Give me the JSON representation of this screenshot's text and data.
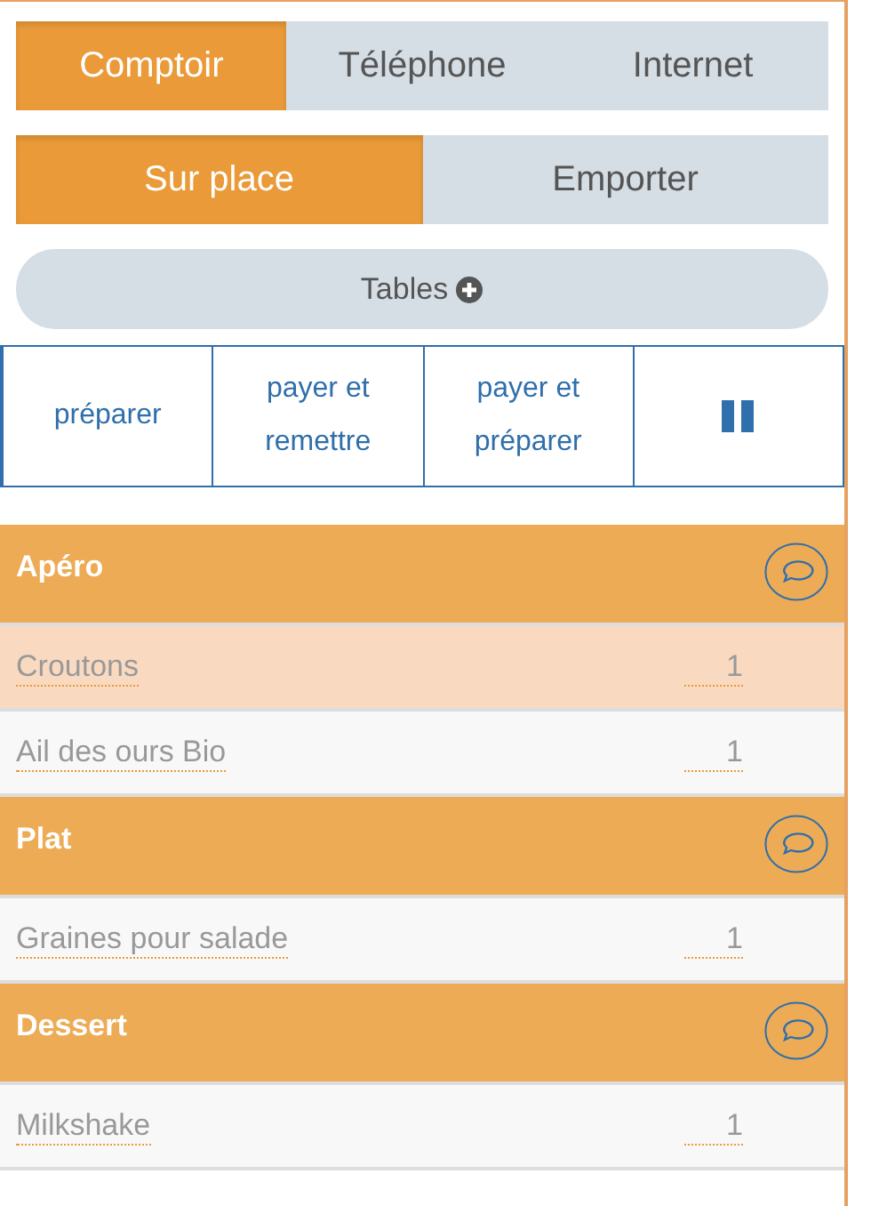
{
  "channel_tabs": [
    {
      "label": "Comptoir",
      "selected": true
    },
    {
      "label": "Téléphone",
      "selected": false
    },
    {
      "label": "Internet",
      "selected": false
    }
  ],
  "service_tabs": [
    {
      "label": "Sur place",
      "selected": true
    },
    {
      "label": "Emporter",
      "selected": false
    }
  ],
  "tables_button": {
    "label": "Tables"
  },
  "actions": [
    {
      "kind": "text",
      "label": "préparer"
    },
    {
      "kind": "text",
      "label": "payer et remettre"
    },
    {
      "kind": "text",
      "label": "payer et préparer"
    },
    {
      "kind": "pause"
    }
  ],
  "categories": [
    {
      "name": "Apéro",
      "items": [
        {
          "name": "Croutons",
          "quantity": "1",
          "selected": true
        },
        {
          "name": "Ail des ours Bio",
          "quantity": "1",
          "selected": false
        }
      ]
    },
    {
      "name": "Plat",
      "items": [
        {
          "name": "Graines pour salade",
          "quantity": "1",
          "selected": false
        }
      ]
    },
    {
      "name": "Dessert",
      "items": [
        {
          "name": "Milkshake",
          "quantity": "1",
          "selected": false
        }
      ]
    }
  ]
}
